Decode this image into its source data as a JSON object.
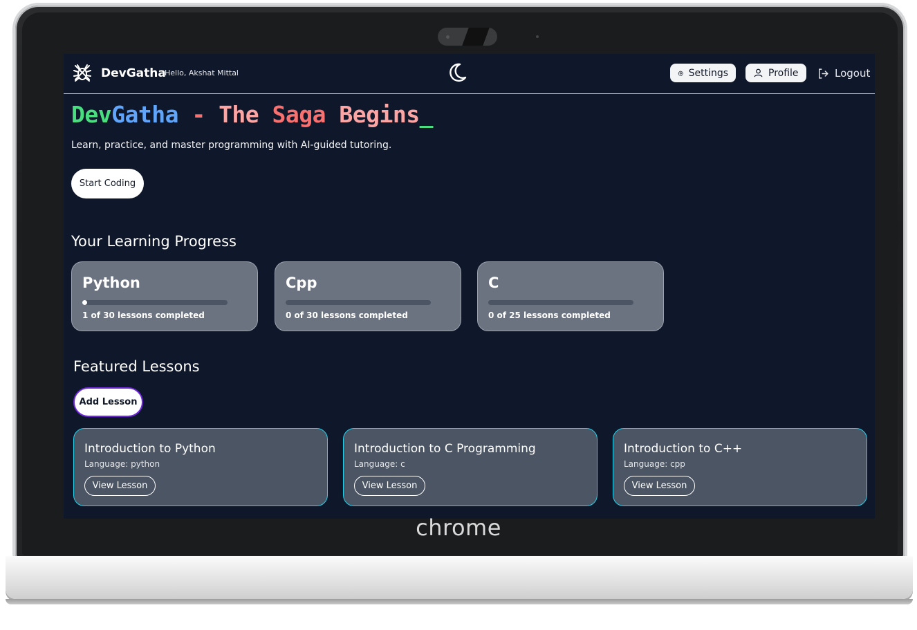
{
  "app": {
    "brand": "DevGatha",
    "greeting": "Hello, Akshat Mittal"
  },
  "nav": {
    "settings_label": "Settings",
    "profile_label": "Profile",
    "logout_label": "Logout"
  },
  "hero": {
    "title_parts": [
      {
        "text": "Dev",
        "color": "#4ade80"
      },
      {
        "text": "Gatha",
        "color": "#60a5fa"
      },
      {
        "text": " - ",
        "color": "#f87171"
      },
      {
        "text": "The ",
        "color": "#fca5a5"
      },
      {
        "text": "Saga ",
        "color": "#f87171"
      },
      {
        "text": "Begins",
        "color": "#fca5a5"
      },
      {
        "text": "_",
        "color": "#4ade80"
      }
    ],
    "tagline": "Learn, practice, and master programming with AI-guided tutoring.",
    "cta_label": "Start Coding"
  },
  "progress": {
    "title": "Your Learning Progress",
    "cards": [
      {
        "language": "Python",
        "completed_text": "1 of 30 lessons completed",
        "fraction": 0.033
      },
      {
        "language": "Cpp",
        "completed_text": "0 of 30 lessons completed",
        "fraction": 0
      },
      {
        "language": "C",
        "completed_text": "0 of 25 lessons completed",
        "fraction": 0
      }
    ]
  },
  "featured": {
    "title": "Featured Lessons",
    "add_label": "Add Lesson",
    "lessons": [
      {
        "title": "Introduction to Python",
        "language": "Language: python",
        "button": "View Lesson"
      },
      {
        "title": "Introduction to C Programming",
        "language": "Language: c",
        "button": "View Lesson"
      },
      {
        "title": "Introduction to C++",
        "language": "Language: cpp",
        "button": "View Lesson"
      }
    ]
  },
  "device": {
    "brand_label": "chrome"
  },
  "colors": {
    "background": "#0f172a",
    "card_progress": "#6b7280",
    "card_lesson": "#4b5563",
    "lesson_border": "#22d3ee"
  }
}
